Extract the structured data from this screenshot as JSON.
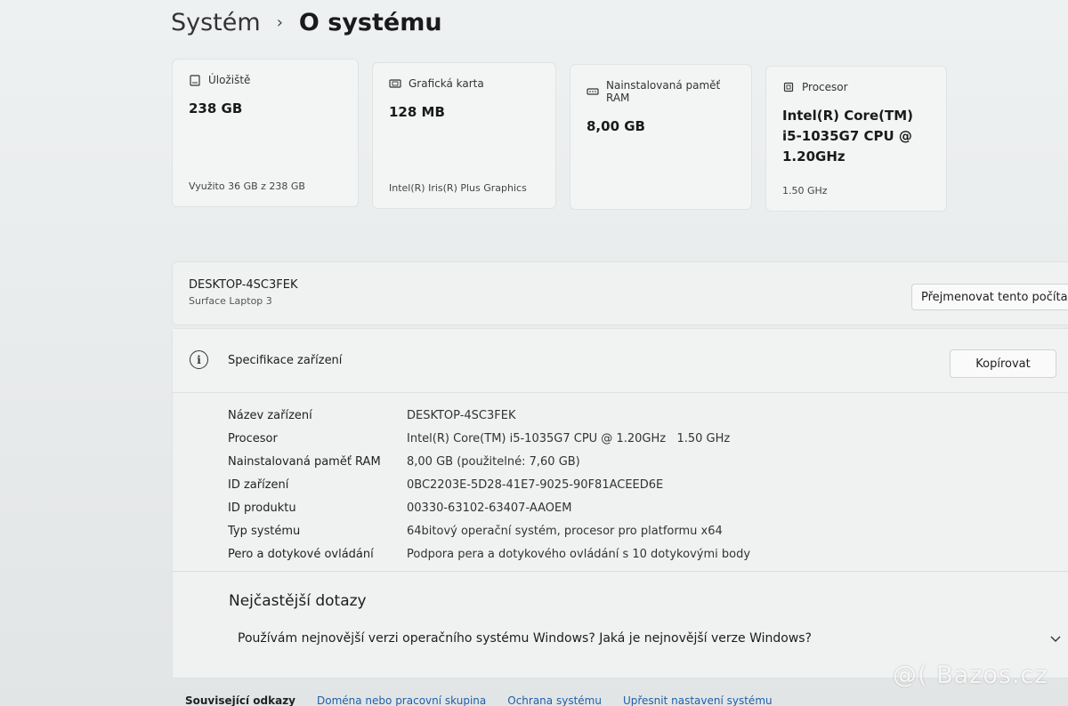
{
  "breadcrumb": {
    "parent": "Systém",
    "current": "O systému"
  },
  "cards": [
    {
      "icon": "storage-icon",
      "title": "Úložiště",
      "value": "238 GB",
      "sub": "Využito 36 GB z 238 GB"
    },
    {
      "icon": "graphics-card-icon",
      "title": "Grafická karta",
      "value": "128 MB",
      "sub": "Intel(R) Iris(R) Plus Graphics"
    },
    {
      "icon": "ram-icon",
      "title": "Nainstalovaná paměť RAM",
      "value": "8,00 GB",
      "sub": ""
    },
    {
      "icon": "processor-icon",
      "title": "Procesor",
      "value": "Intel(R) Core(TM) i5-1035G7 CPU @ 1.20GHz",
      "sub": "1.50 GHz"
    }
  ],
  "device": {
    "name": "DESKTOP-4SC3FEK",
    "model": "Surface Laptop 3",
    "rename_label": "Přejmenovat tento počítač"
  },
  "specs": {
    "title": "Specifikace zařízení",
    "copy_label": "Kopírovat",
    "rows": [
      {
        "label": "Název zařízení",
        "value": "DESKTOP-4SC3FEK"
      },
      {
        "label": "Procesor",
        "value": "Intel(R) Core(TM) i5-1035G7 CPU @ 1.20GHz   1.50 GHz"
      },
      {
        "label": "Nainstalovaná paměť RAM",
        "value": "8,00 GB (použitelné: 7,60 GB)"
      },
      {
        "label": "ID zařízení",
        "value": "0BC2203E-5D28-41E7-9025-90F81ACEED6E"
      },
      {
        "label": "ID produktu",
        "value": "00330-63102-63407-AAOEM"
      },
      {
        "label": "Typ systému",
        "value": "64bitový operační systém, procesor pro platformu x64"
      },
      {
        "label": "Pero a dotykové ovládání",
        "value": "Podpora pera a dotykového ovládání s 10 dotykovými body"
      }
    ]
  },
  "faq": {
    "title": "Nejčastější dotazy",
    "question": "Používám nejnovější verzi operačního systému Windows? Jaká je nejnovější verze Windows?"
  },
  "related": {
    "label": "Související odkazy",
    "links": [
      "Doména nebo pracovní skupina",
      "Ochrana systému",
      "Upřesnit nastavení systému"
    ]
  },
  "watermark": "@( Bazos.cz"
}
